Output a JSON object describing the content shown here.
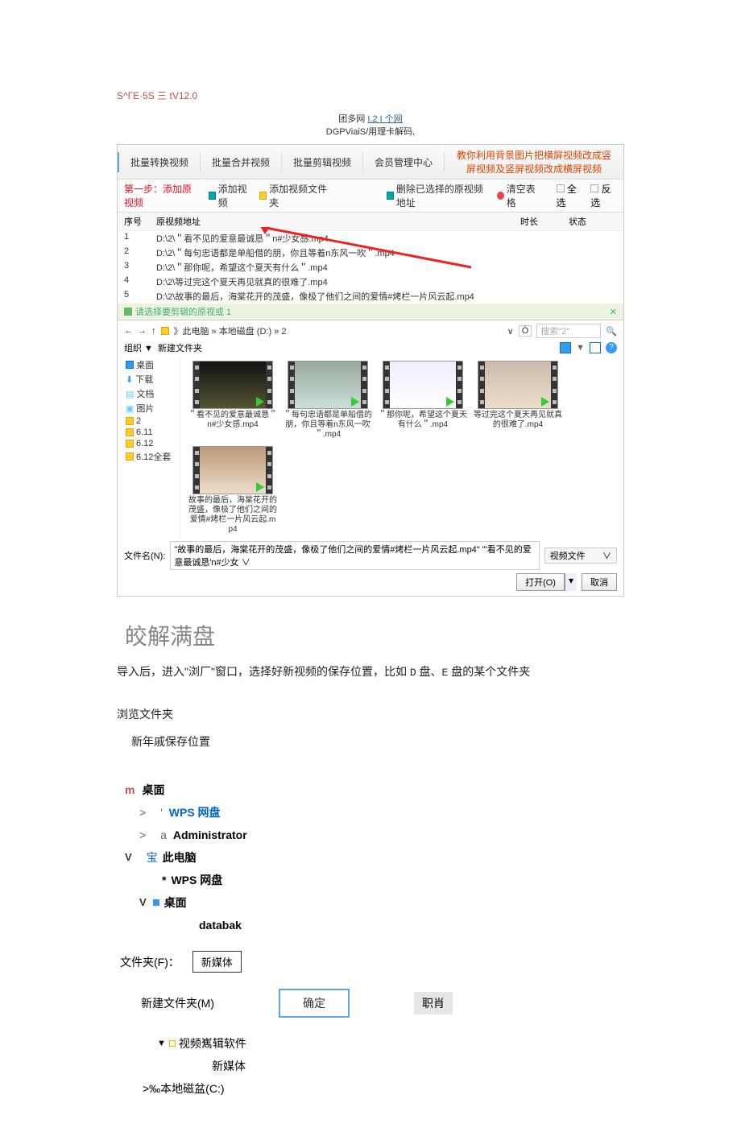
{
  "doc": {
    "top_code": "S^ГE·5S 三 tV12.0",
    "center_line1_a": "团多网",
    "center_line1_b": "I.2 I 个网",
    "center_line2": "DGPViaiS/用理卡解码,"
  },
  "app": {
    "tabs": [
      "批量转换视频",
      "批量合并视频",
      "批量剪辑视频",
      "会员管理中心"
    ],
    "right_hint": "教你利用背景图片把横屏视频改成竖屏视频及竖屏视频改成横屏视频",
    "toolbar": {
      "step": "第一步：添加原视频",
      "add_video": "添加视频",
      "add_folder": "添加视频文件夹",
      "delete_sel": "删除已选择的原视频地址",
      "clear": "清空表格",
      "sel_all": "全选",
      "invert": "反选"
    },
    "cols": {
      "idx": "序号",
      "path": "原视频地址",
      "dur": "时长",
      "status": "状态"
    },
    "rows": [
      {
        "idx": "1",
        "path": "D:\\2\\＂看不见的爱意最诚恳＂n#少女感.mp4"
      },
      {
        "idx": "2",
        "path": "D:\\2\\＂每句忠语都是单船借的朋，你且等着n东风一吹＂.mp4"
      },
      {
        "idx": "3",
        "path": "D:\\2\\＂那你呢，希望这个夏天有什么＂.mp4"
      },
      {
        "idx": "4",
        "path": "D:\\2\\等过完这个夏天再见就真的很难了.mp4"
      },
      {
        "idx": "5",
        "path": "D:\\2\\故事的最后，海棠花开的茂盛，像极了他们之间的爱情#烤栏一片风云起.mp4"
      }
    ],
    "status_strip": "请选择要剪辑的原视或 1",
    "dialog": {
      "path": "》此电脑 » 本地磁盘 (D:) » 2",
      "search_placeholder": "搜索\"2\"",
      "organize": "组织 ▼",
      "newfolder": "新建文件夹",
      "sidebar": [
        "桌面",
        "下载",
        "文档",
        "图片",
        "2",
        "6.11",
        "6.12",
        "6.12全套"
      ],
      "thumbs": [
        "＂看不见的爱意最诚恳＂n#少女感.mp4",
        "＂每句忠语都是单船借的朋，你且等着n东风一吹＂.mp4",
        "＂那你呢，希望这个夏天有什么＂.mp4",
        "等过完这个夏天再见就真的很难了.mp4",
        "故事的最后，海棠花开的茂盛，像极了他们之间的爱情#烤栏一片风云起.mp4"
      ],
      "fn_label": "文件名(N):",
      "fn_value": "\"故事的最后，海棠花开的茂盛，像极了他们之间的爱情#烤栏一片风云起.mp4\" \"'看不见的爱意最诚恳'n#少女 ∨",
      "filter": "视频文件",
      "open": "打开(O)",
      "cancel": "取消"
    }
  },
  "body": {
    "heading": "皎解满盘",
    "para": "导入后，进入\"浏厂\"窗口，选择好新视频的保存位置，比如 D 盘、E 盘的某个文件夹",
    "browse_title": "浏览文件夹",
    "save_loc": "新年戚保存位置"
  },
  "tree": {
    "n1_pref": "m",
    "n1": " 桌面",
    "n2_pref": "'",
    "n2": "WPS 网盘",
    "n3_pref": "a",
    "n3": "Administrator",
    "n4_pref": "宝",
    "n4": "此电脑",
    "n5_pref": "*",
    "n5": "WPS 网盘",
    "n6": "桌面",
    "n7": "databak"
  },
  "folder_field": {
    "label": "文件夹(F)：",
    "value": "新媒体"
  },
  "ok_row": {
    "mk": "新建文件夹(M)",
    "ok": "确定",
    "cancel": "职肖"
  },
  "tail": {
    "t1": "视频嶲辑软件",
    "t2": "新媒体",
    "t3": ">‰本地磁盆(C:)"
  }
}
